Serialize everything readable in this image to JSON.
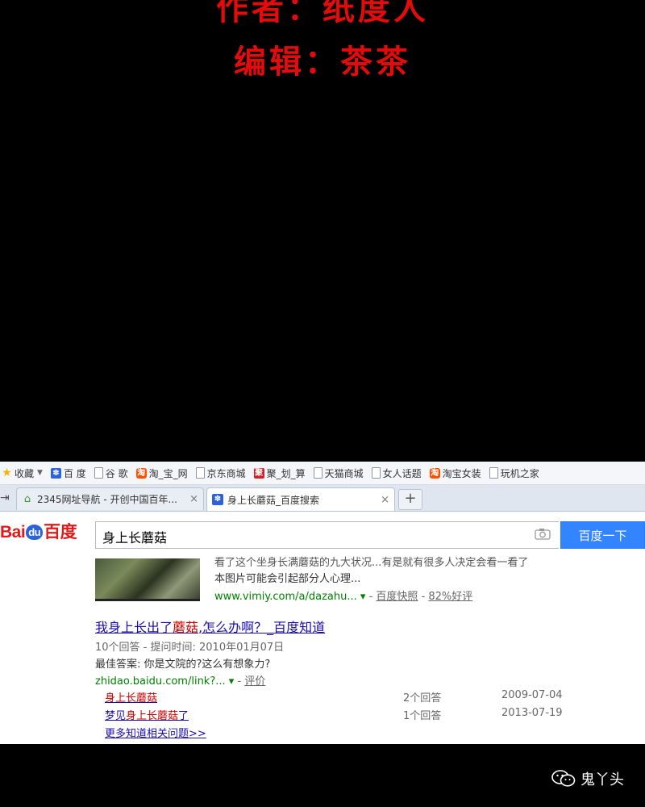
{
  "credits": {
    "author": "作者：纸度人",
    "editor": "编辑：茶茶"
  },
  "browser": {
    "bookmarks": [
      {
        "label": "收藏",
        "icon": "star-icon"
      },
      {
        "label": "百 度",
        "icon": "baidu-paw-icon"
      },
      {
        "label": "谷 歌",
        "icon": "page-icon"
      },
      {
        "label": "淘_宝_网",
        "icon": "taobao-icon"
      },
      {
        "label": "京东商城",
        "icon": "page-icon"
      },
      {
        "label": "聚_划_算",
        "icon": "juhuasuan-icon"
      },
      {
        "label": "天猫商城",
        "icon": "page-icon"
      },
      {
        "label": "女人话题",
        "icon": "page-icon"
      },
      {
        "label": "淘宝女装",
        "icon": "taobao-icon"
      },
      {
        "label": "玩机之家",
        "icon": "page-icon"
      }
    ],
    "tabs": [
      {
        "label": "2345网址导航 - 开创中国百年...",
        "icon": "house-icon"
      },
      {
        "label": "身上长蘑菇_百度搜索",
        "icon": "baidu-paw-icon"
      }
    ],
    "new_tab": "+",
    "close": "×"
  },
  "search": {
    "logo_bai": "Bai",
    "logo_du": "du",
    "logo_cn": "百度",
    "query": "身上长蘑菇",
    "button": "百度一下"
  },
  "results": {
    "r1": {
      "snippet_top": "看了这个坐身长满蘑菇的九大状况...有是就有很多人决定会看一看了",
      "snippet": "本图片可能会引起部分人心理...",
      "url": "www.vimiy.com/a/dazahu...",
      "cache": "百度快照",
      "rating": "82%好评"
    },
    "r2": {
      "title_pre": "我身上长出了",
      "title_em": "蘑菇",
      "title_post": ",怎么办啊？_百度知道",
      "meta": "10个回答 - 提问时间: 2010年01月07日",
      "best": "最佳答案: 你是文院的?这么有想象力?",
      "url": "zhidao.baidu.com/link?...",
      "rate": "评价",
      "related": [
        {
          "q_pre": "",
          "q_em": "身上长蘑菇",
          "q_post": "",
          "answers": "2个回答",
          "date": "2009-07-04"
        },
        {
          "q_pre": "梦见",
          "q_em": "身上长蘑菇",
          "q_post": "了",
          "answers": "1个回答",
          "date": "2013-07-19"
        }
      ],
      "more": "更多知道相关问题>>"
    }
  },
  "watermark": "鬼丫头"
}
